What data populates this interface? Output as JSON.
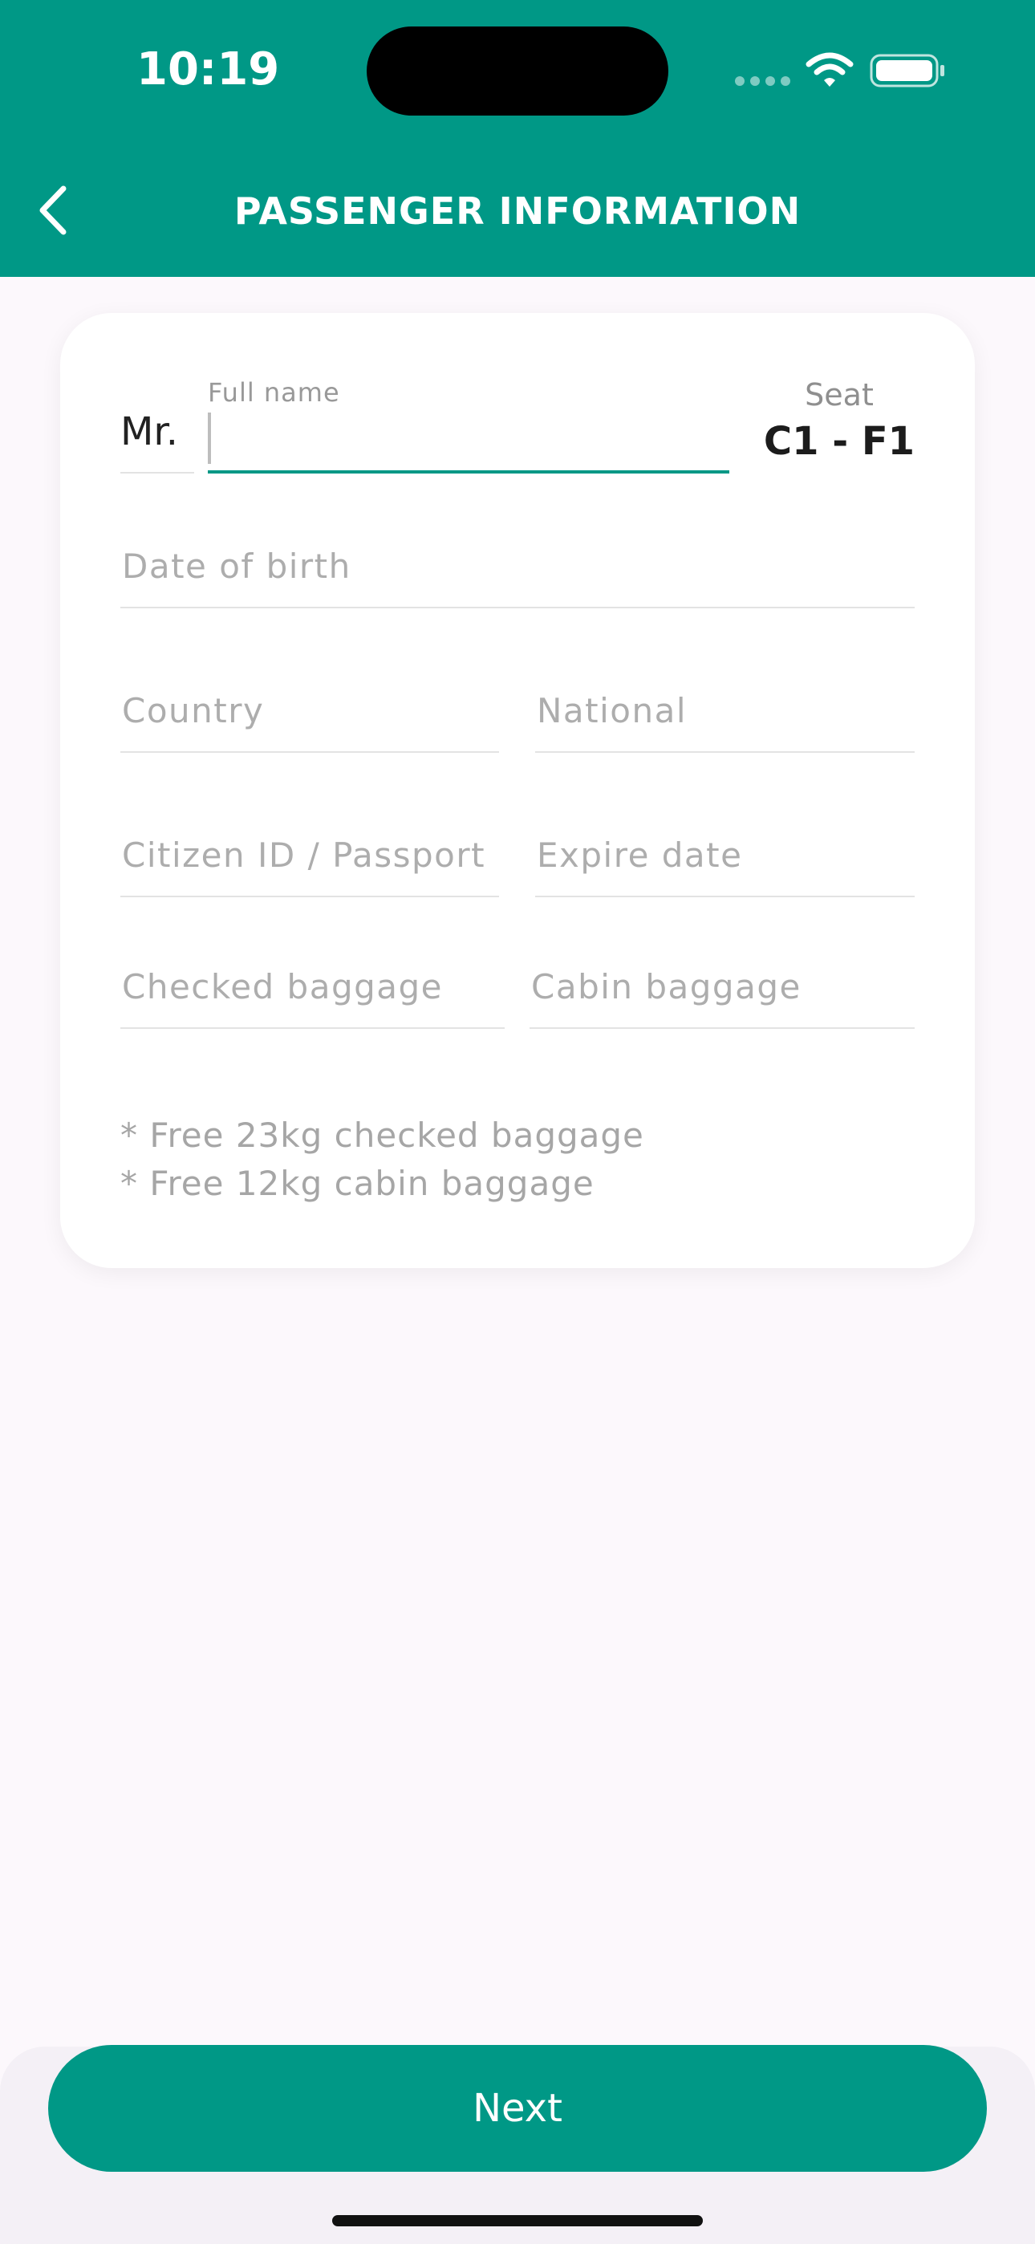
{
  "status_bar": {
    "time": "10:19",
    "icons": [
      "signal-icon",
      "wifi-icon",
      "battery-icon"
    ]
  },
  "header": {
    "title": "PASSENGER INFORMATION",
    "back_icon": "chevron-left-icon"
  },
  "form": {
    "title_value": "Mr.",
    "full_name_label": "Full name",
    "full_name_value": "",
    "seat_label": "Seat",
    "seat_value": "C1 - F1",
    "date_of_birth_placeholder": "Date of birth",
    "country_placeholder": "Country",
    "national_placeholder": "National",
    "citizen_id_placeholder": "Citizen ID / Passport",
    "expire_date_placeholder": "Expire date",
    "checked_baggage_placeholder": "Checked baggage",
    "cabin_baggage_placeholder": "Cabin baggage",
    "notes": [
      "* Free 23kg checked baggage",
      "* Free 12kg cabin baggage"
    ]
  },
  "footer": {
    "next_label": "Next"
  },
  "colors": {
    "accent": "#009886",
    "background": "#fcf8fc",
    "card": "#ffffff",
    "placeholder": "#adadad"
  }
}
